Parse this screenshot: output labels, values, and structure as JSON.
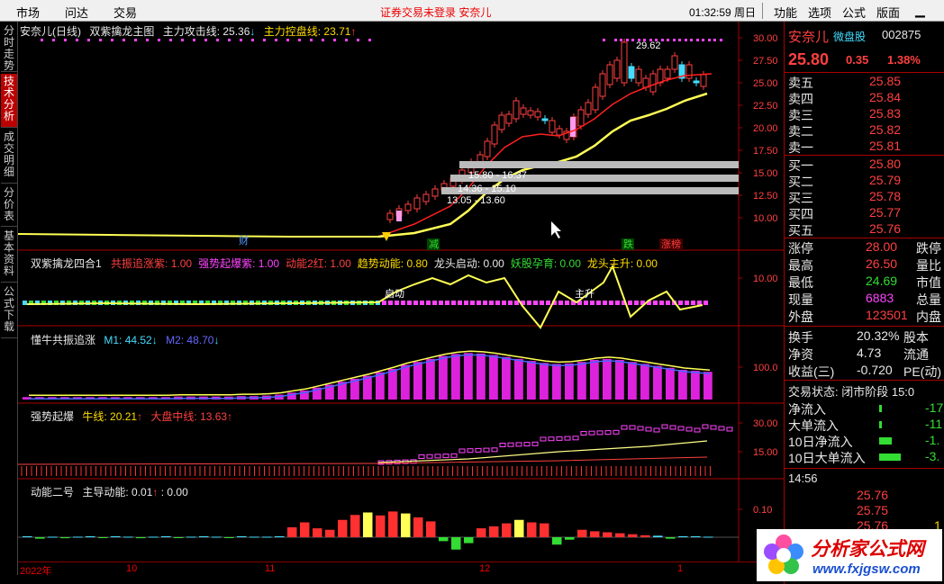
{
  "topbar": {
    "menu": [
      "市场",
      "问达",
      "交易"
    ],
    "notice": "证券交易未登录  安奈儿",
    "clock": "01:32:59 周日",
    "right_menu": [
      "功能",
      "选项",
      "公式",
      "版面"
    ]
  },
  "left_tabs": [
    "分时走势",
    "技术分析",
    "成交明细",
    "分价表",
    "基本资料",
    "公式下载"
  ],
  "main": {
    "title": "安奈儿(日线)",
    "indicator": "双紫擒龙主图",
    "line1_label": "主力攻击线: 25.36",
    "line1_arrow": "↓",
    "line2_label": "主力控盘线: 23.71",
    "line2_arrow": "↑",
    "high_label": "29.62",
    "zones": [
      "15.80 - 16.37",
      "14.36 - 15.10",
      "13.05 - 13.60"
    ],
    "markers": [
      "财",
      "减",
      "跌",
      "涨榜"
    ],
    "y_ticks": [
      "30.00",
      "27.50",
      "25.00",
      "22.50",
      "20.00",
      "17.50",
      "15.00",
      "12.50",
      "10.00"
    ]
  },
  "panel2": {
    "name": "双紫擒龙四合1",
    "items": [
      {
        "t": "共振追涨紫: 1.00",
        "c": "#ff4040"
      },
      {
        "t": "强势起爆紫: 1.00",
        "c": "#ff44ff"
      },
      {
        "t": "动能2红: 1.00",
        "c": "#ff4040"
      },
      {
        "t": "趋势动能: 0.80",
        "c": "#ffdd00"
      },
      {
        "t": "龙头启动: 0.00",
        "c": "#e8e8e8"
      },
      {
        "t": "妖股孕育: 0.00",
        "c": "#33dd33"
      },
      {
        "t": "龙头主升: 0.00",
        "c": "#ffdd00"
      }
    ],
    "labels": [
      "启动",
      "主升"
    ],
    "y_tick": "10.00"
  },
  "panel3": {
    "name": "懂牛共振追涨",
    "m1": "M1: 44.52",
    "m1_arrow": "↓",
    "m2": "M2: 48.70",
    "m2_arrow": "↓",
    "y_tick": "100.0",
    "values": [
      5,
      5,
      5,
      5,
      5,
      5,
      5,
      5,
      5,
      5,
      5,
      5,
      6,
      6,
      6,
      6,
      6,
      7,
      7,
      8,
      10,
      14,
      18,
      24,
      30,
      36,
      42,
      48,
      55,
      62,
      70,
      76,
      82,
      88,
      92,
      94,
      93,
      90,
      86,
      82,
      78,
      74,
      72,
      73,
      76,
      80,
      82,
      80,
      76,
      72,
      68,
      64,
      60,
      58,
      56
    ]
  },
  "panel4": {
    "name": "强势起爆",
    "niu": "牛线: 20.21",
    "niu_arrow": "↑",
    "dapan": "大盘中线: 13.63",
    "dapan_arrow": "↑",
    "y_ticks": [
      "30.00",
      "15.00"
    ]
  },
  "panel5": {
    "name": "动能二号",
    "zhudao": "主导动能: 0.01",
    "zhudao_arrow": "↑",
    "extra": ": 0.00",
    "y_tick": "0.10",
    "values": [
      2,
      -3,
      1,
      -2,
      1,
      2,
      -1,
      2,
      1,
      -2,
      1,
      2,
      -1,
      1,
      2,
      1,
      -1,
      2,
      1,
      1,
      2,
      20,
      30,
      18,
      15,
      35,
      45,
      50,
      44,
      52,
      48,
      40,
      32,
      -8,
      -25,
      -12,
      18,
      22,
      28,
      35,
      30,
      28,
      -15,
      -5,
      15,
      12,
      10,
      8,
      6,
      4,
      3,
      -3,
      2,
      2,
      1
    ]
  },
  "bottom": {
    "labels": [
      "2022年",
      "10",
      "11",
      "12",
      "1"
    ]
  },
  "quote": {
    "name": "安奈儿",
    "tag": "微盘股",
    "code": "002875",
    "price": "25.80",
    "change": "0.35",
    "pct": "1.38%",
    "asks": [
      {
        "l": "卖五",
        "p": "25.85"
      },
      {
        "l": "卖四",
        "p": "25.84"
      },
      {
        "l": "卖三",
        "p": "25.83"
      },
      {
        "l": "卖二",
        "p": "25.82"
      },
      {
        "l": "卖一",
        "p": "25.81"
      }
    ],
    "bids": [
      {
        "l": "买一",
        "p": "25.80"
      },
      {
        "l": "买二",
        "p": "25.79"
      },
      {
        "l": "买三",
        "p": "25.78"
      },
      {
        "l": "买四",
        "p": "25.77"
      },
      {
        "l": "买五",
        "p": "25.76"
      }
    ],
    "stats": [
      {
        "l": "涨停",
        "v": "28.00",
        "c": "#ff4040",
        "r": "跌停"
      },
      {
        "l": "最高",
        "v": "26.50",
        "c": "#ff4040",
        "r": "量比"
      },
      {
        "l": "最低",
        "v": "24.69",
        "c": "#33dd33",
        "r": "市值"
      },
      {
        "l": "现量",
        "v": "6883",
        "c": "#ff44ff",
        "r": "总量"
      },
      {
        "l": "外盘",
        "v": "123501",
        "c": "#ff4040",
        "r": "内盘"
      }
    ],
    "stats2": [
      {
        "l": "换手",
        "v": "20.32%",
        "r": "股本"
      },
      {
        "l": "净资",
        "v": "4.73",
        "r": "流通"
      },
      {
        "l": "收益(三)",
        "v": "-0.720",
        "r": "PE(动)"
      }
    ],
    "trade_status": "交易状态: 闭市阶段 15:0",
    "flows": [
      {
        "l": "净流入",
        "v": "-17"
      },
      {
        "l": "大单流入",
        "v": "-11"
      },
      {
        "l": "10日净流入",
        "v": "-1."
      },
      {
        "l": "10日大单流入",
        "v": "-3."
      }
    ],
    "ticks_time": "14:56",
    "ticks": [
      {
        "p": "25.76",
        "v": ""
      },
      {
        "p": "25.75",
        "v": ""
      },
      {
        "p": "25.76",
        "v": "1"
      },
      {
        "p": "25.78",
        "v": "2"
      }
    ]
  },
  "logo": {
    "text": "分析家公式网",
    "url": "www.fxjgsw.com"
  }
}
